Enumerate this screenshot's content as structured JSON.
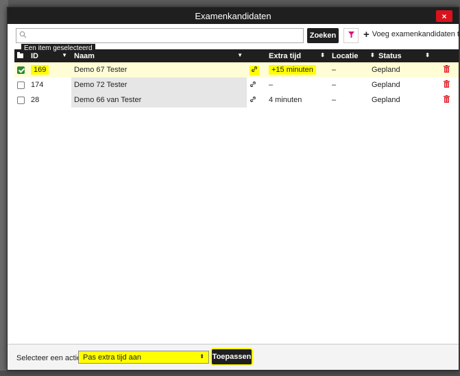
{
  "dialog": {
    "title": "Examenkandidaten",
    "close_label": "×"
  },
  "toolbar": {
    "search_placeholder": "",
    "search_value": "",
    "search_button": "Zoeken",
    "filter_icon": "filter-icon",
    "add_button": "Voeg examenkandidaten toe"
  },
  "tooltip": "Een item geselecteerd",
  "table": {
    "columns": {
      "id": "ID",
      "naam": "Naam",
      "extra_tijd": "Extra tijd",
      "locatie": "Locatie",
      "status": "Status"
    },
    "rows": [
      {
        "checked": true,
        "id": "169",
        "naam": "Demo 67 Tester",
        "extra_tijd": "+15 minuten",
        "locatie": "–",
        "status": "Gepland"
      },
      {
        "checked": false,
        "id": "174",
        "naam": "Demo 72 Tester",
        "extra_tijd": "–",
        "locatie": "–",
        "status": "Gepland"
      },
      {
        "checked": false,
        "id": "28",
        "naam": "Demo 66 van Tester",
        "extra_tijd": "4 minuten",
        "locatie": "–",
        "status": "Gepland"
      }
    ]
  },
  "footer": {
    "action_label": "Selecteer een actie:",
    "action_value": "Pas extra tijd aan",
    "apply_button": "Toepassen"
  },
  "colors": {
    "header_bg": "#1f1f1f",
    "close_red": "#d9121d",
    "highlight": "#ffff00",
    "filter_pink": "#e0107a"
  }
}
